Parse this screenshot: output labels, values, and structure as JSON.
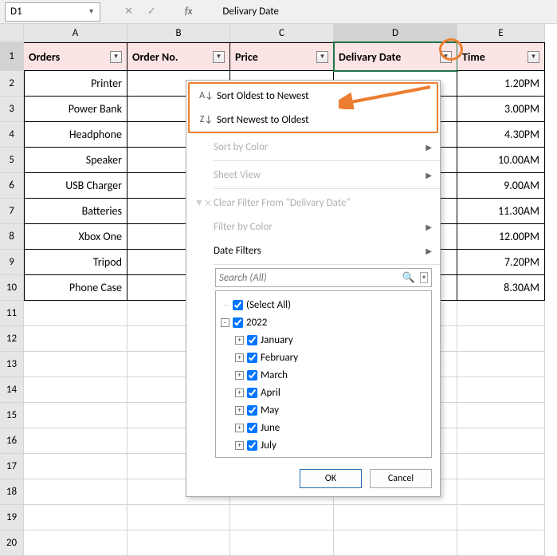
{
  "formula_bar": {
    "cell_ref": "D1",
    "value": "Delivary Date",
    "fx": "fx"
  },
  "columns": [
    "A",
    "B",
    "C",
    "D",
    "E"
  ],
  "selected_col": "D",
  "headers": {
    "A": "Orders",
    "B": "Order No.",
    "C": "Price",
    "D": "Delivary Date",
    "E": "Time"
  },
  "rows": [
    {
      "n": 2,
      "A": "Printer",
      "E": "1.20PM"
    },
    {
      "n": 3,
      "A": "Power Bank",
      "E": "3.00PM"
    },
    {
      "n": 4,
      "A": "Headphone",
      "E": "4.30PM"
    },
    {
      "n": 5,
      "A": "Speaker",
      "E": "10.00AM"
    },
    {
      "n": 6,
      "A": "USB Charger",
      "E": "9.00AM"
    },
    {
      "n": 7,
      "A": "Batteries",
      "E": "11.30AM"
    },
    {
      "n": 8,
      "A": "Xbox One",
      "E": "12.00PM"
    },
    {
      "n": 9,
      "A": "Tripod",
      "E": "7.20PM"
    },
    {
      "n": 10,
      "A": "Phone Case",
      "E": "8.30AM"
    }
  ],
  "empty_rows": [
    11,
    12,
    13,
    14,
    15,
    16,
    17,
    18,
    19,
    20
  ],
  "menu": {
    "sort_asc": "Sort Oldest to Newest",
    "sort_desc": "Sort Newest to Oldest",
    "sort_color": "Sort by Color",
    "sheet_view": "Sheet View",
    "clear_filter": "Clear Filter From \"Delivary Date\"",
    "filter_color": "Filter by Color",
    "date_filters": "Date Filters",
    "search_ph": "Search (All)",
    "select_all": "(Select All)",
    "year": "2022",
    "months": [
      "January",
      "February",
      "March",
      "April",
      "May",
      "June",
      "July"
    ],
    "ok": "OK",
    "cancel": "Cancel"
  }
}
